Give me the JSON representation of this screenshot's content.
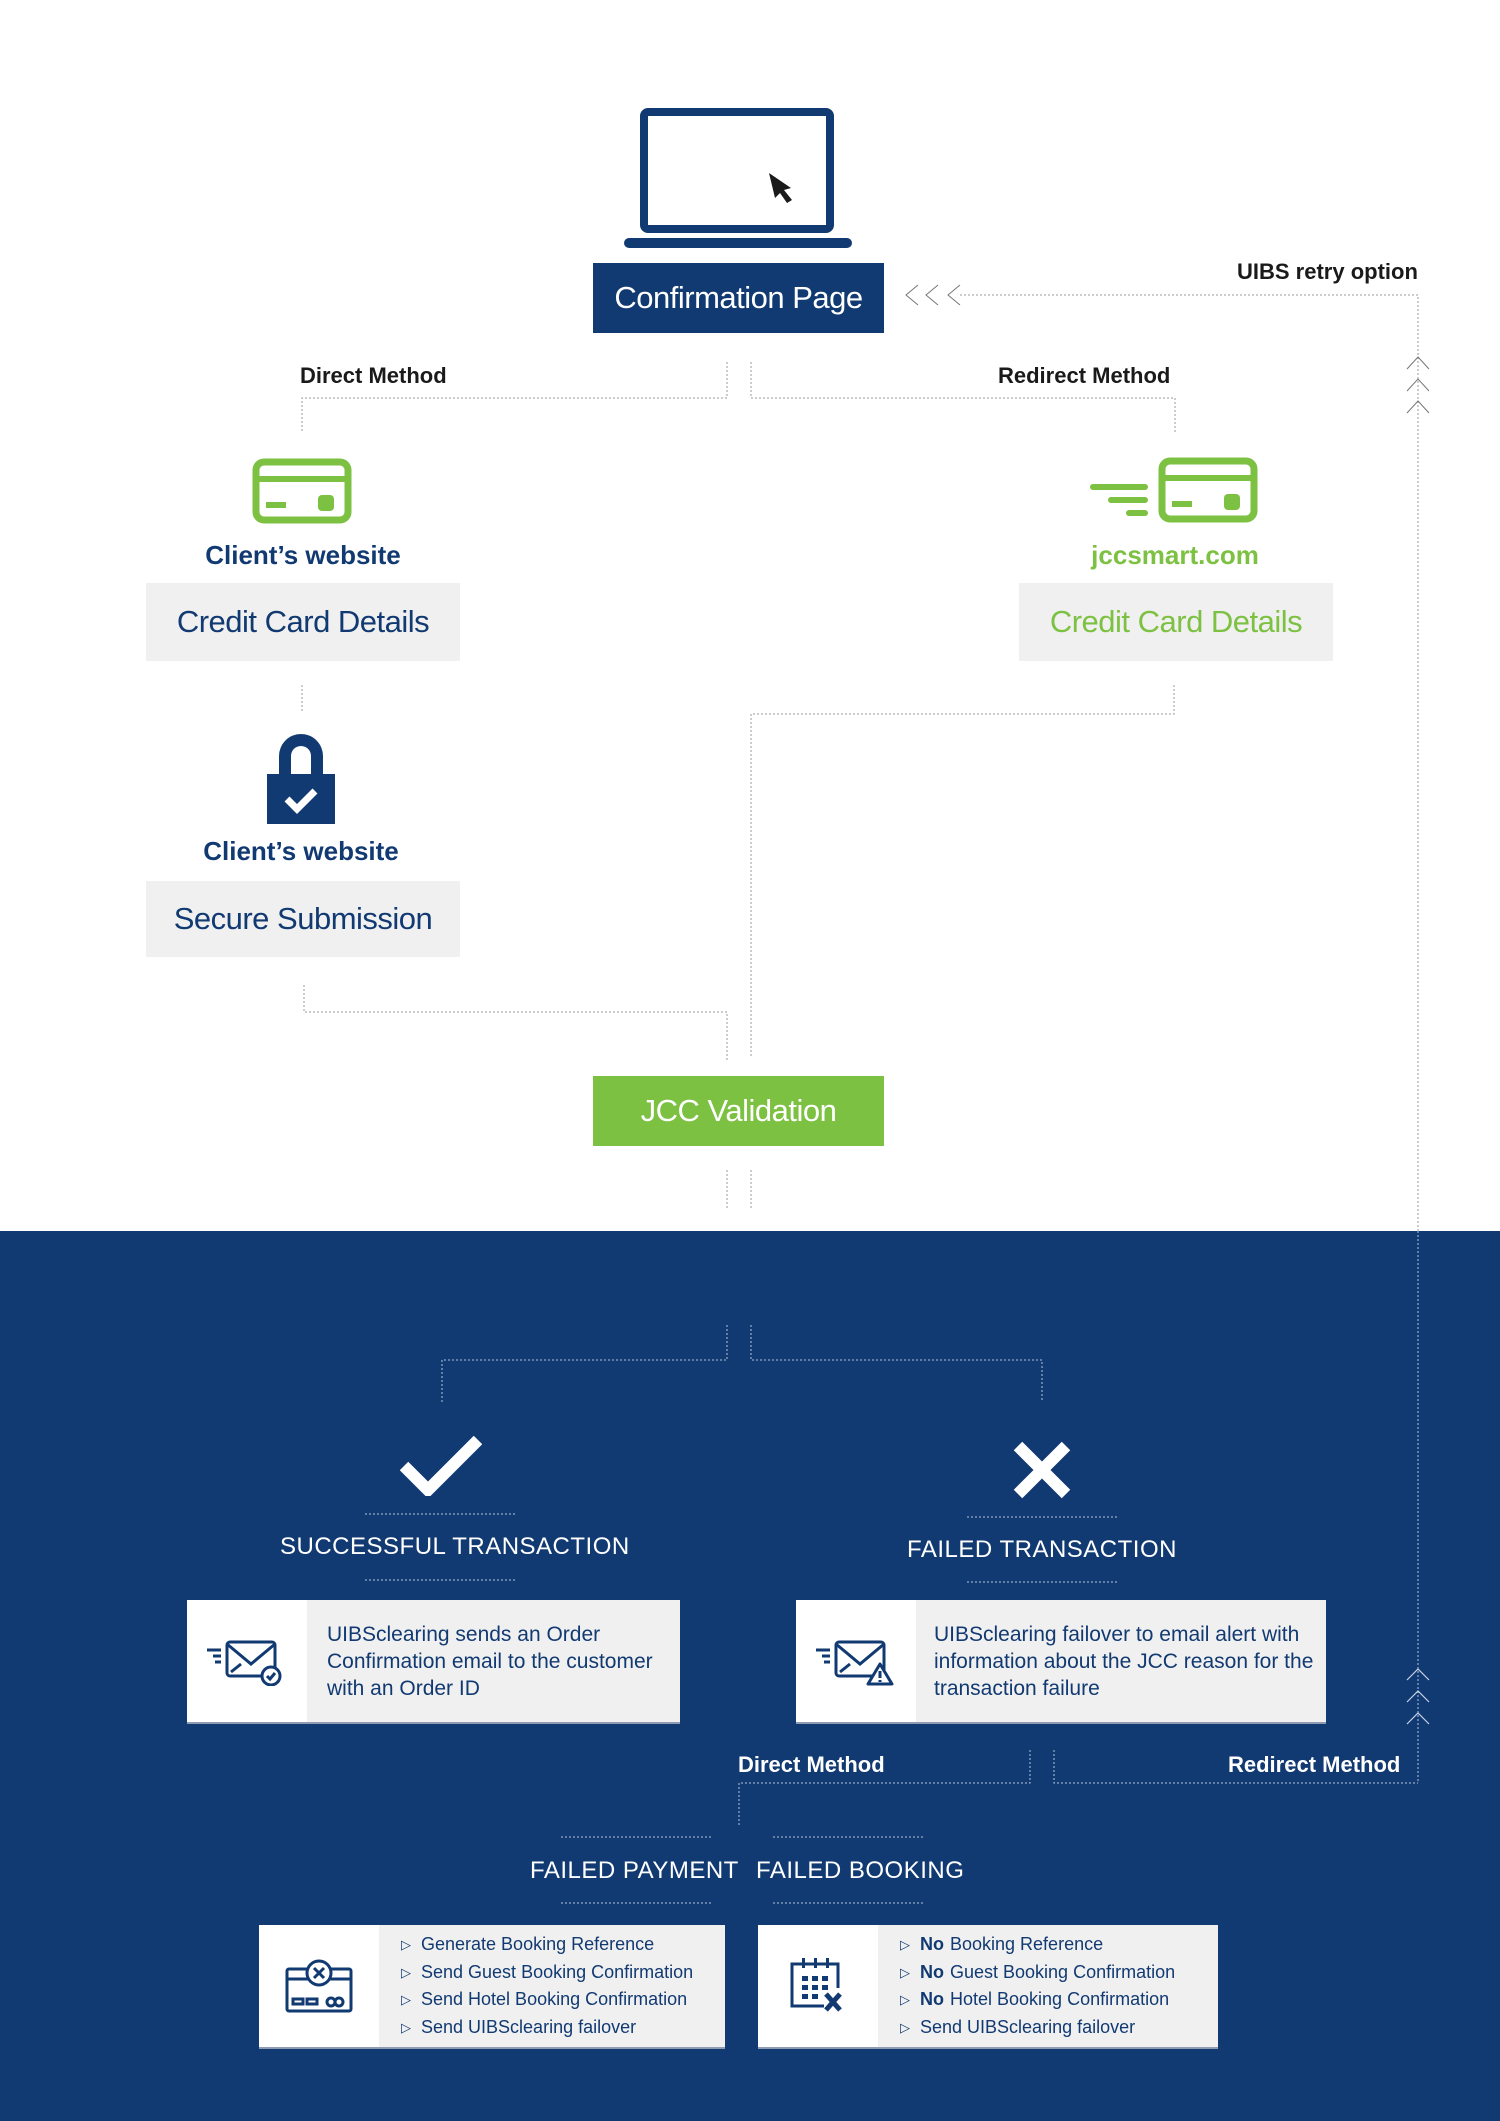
{
  "colors": {
    "navy": "#123a72",
    "green": "#7dc142",
    "grey_box": "#f0f0f0",
    "label_dark": "#1a1a1a"
  },
  "top": {
    "icon": "laptop-cursor-icon",
    "confirmation_page": "Confirmation Page",
    "retry_label": "UIBS retry option",
    "direct_method": "Direct Method",
    "redirect_method": "Redirect Method"
  },
  "direct_branch": {
    "card_icon": "credit-card-icon",
    "source_1": "Client’s website",
    "step_1": "Credit Card Details",
    "lock_icon": "padlock-check-icon",
    "source_2": "Client’s website",
    "step_2": "Secure Submission"
  },
  "redirect_branch": {
    "card_icon": "fast-credit-card-icon",
    "source": "jccsmart.com",
    "step": "Credit Card Details"
  },
  "validation": {
    "label": "JCC Validation"
  },
  "outcomes": {
    "success": {
      "icon": "checkmark-icon",
      "title": "SUCCESSFUL TRANSACTION",
      "card_icon": "email-sent-check-icon",
      "description": "UIBSclearing sends an Order Confirmation email to the customer with an Order ID"
    },
    "failure": {
      "icon": "cross-icon",
      "title": "FAILED TRANSACTION",
      "card_icon": "email-sent-warning-icon",
      "description": "UIBSclearing failover to email alert with information about the JCC reason for the transaction failure"
    },
    "direct_method": "Direct Method",
    "redirect_method": "Redirect Method"
  },
  "failed_payment": {
    "title": "FAILED PAYMENT",
    "icon": "card-declined-icon",
    "items": [
      {
        "prefix": "",
        "text": "Generate Booking Reference"
      },
      {
        "prefix": "",
        "text": "Send Guest Booking Confirmation"
      },
      {
        "prefix": "",
        "text": "Send Hotel Booking Confirmation"
      },
      {
        "prefix": "",
        "text": "Send UIBSclearing failover"
      }
    ]
  },
  "failed_booking": {
    "title": "FAILED BOOKING",
    "icon": "calendar-cancel-icon",
    "items": [
      {
        "prefix": "No",
        "text": "Booking Reference"
      },
      {
        "prefix": "No",
        "text": "Guest Booking Confirmation"
      },
      {
        "prefix": "No",
        "text": "Hotel Booking Confirmation"
      },
      {
        "prefix": "",
        "text": "Send UIBSclearing failover"
      }
    ]
  },
  "bullet_glyph": "▷"
}
